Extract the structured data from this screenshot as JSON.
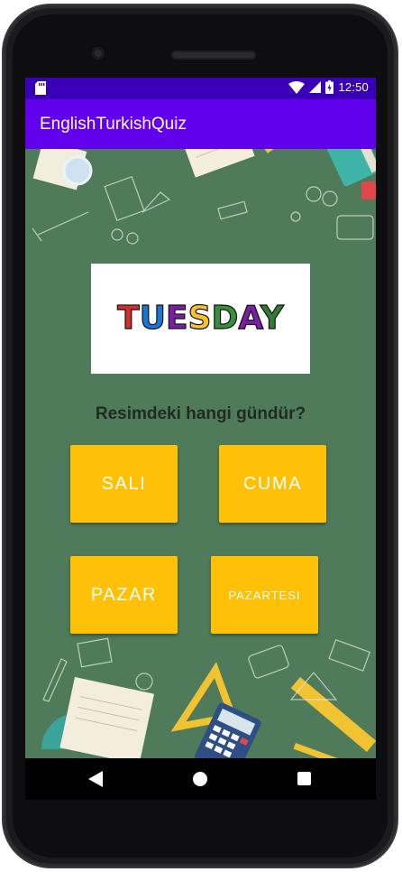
{
  "status_bar": {
    "time": "12:50",
    "icons": [
      "sd-card-icon",
      "wifi-icon",
      "signal-icon",
      "battery-charging-icon"
    ]
  },
  "app_bar": {
    "title": "EnglishTurkishQuiz",
    "color": "#6200ee",
    "status_color": "#3a00b8"
  },
  "quiz": {
    "image_word": "TUESDAY",
    "image_letter_colors": [
      "#d32f2f",
      "#1976d2",
      "#7b1fa2",
      "#fbc02d",
      "#388e3c",
      "#7b1fa2",
      "#2e7d32"
    ],
    "question": "Resimdeki hangi gündür?",
    "options": [
      {
        "label": "SALI"
      },
      {
        "label": "CUMA"
      },
      {
        "label": "PAZAR"
      },
      {
        "label": "PAZARTESI"
      }
    ],
    "button_color": "#ffc107"
  },
  "nav_bar": {
    "icons": [
      "back-icon",
      "home-icon",
      "recents-icon"
    ]
  }
}
